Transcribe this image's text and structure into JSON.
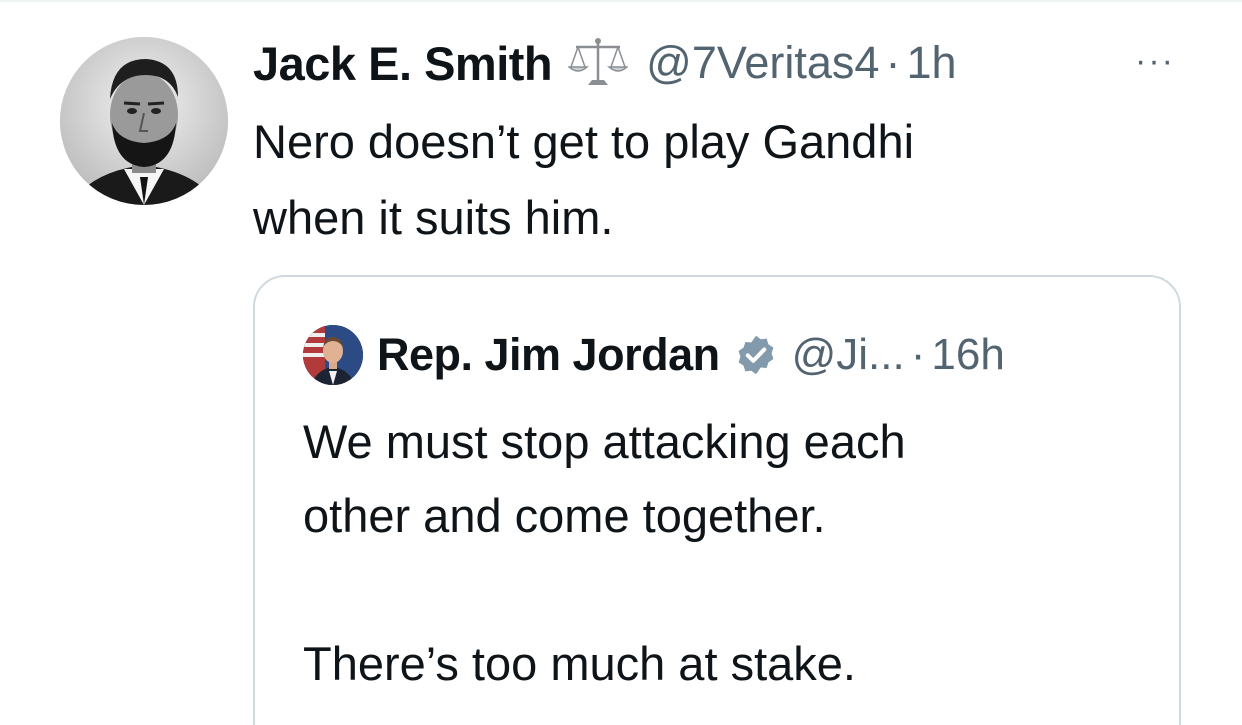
{
  "tweet": {
    "author_name": "Jack E. Smith",
    "badge_icon": "scales-of-justice-icon",
    "handle": "@7Veritas4",
    "separator": "·",
    "time": "1h",
    "more_label": "···",
    "text": "Nero doesn’t get to play Gandhi\nwhen it suits him."
  },
  "quoted_tweet": {
    "author_name": "Rep. Jim Jordan",
    "verified_icon": "verified-badge-icon",
    "handle": "@Ji...",
    "separator": "·",
    "time": "16h",
    "text": "We must stop attacking each\nother and come together.\n\nThere’s too much at stake."
  },
  "colors": {
    "text_primary": "#0f1419",
    "text_secondary": "#536471",
    "border": "#cfd9de",
    "verified": "#829aab"
  }
}
